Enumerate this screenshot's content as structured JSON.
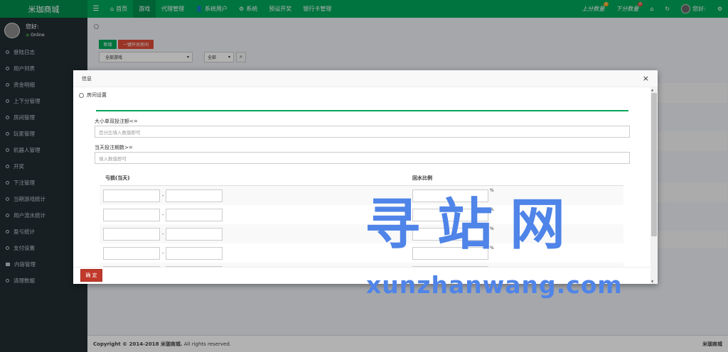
{
  "header": {
    "logo": "米珈商城",
    "toggle_icon": "bars-icon",
    "nav": [
      {
        "label": "首页",
        "icon": "home-icon"
      },
      {
        "label": "游戏",
        "active": true
      },
      {
        "label": "代理管理"
      },
      {
        "label": "系统用户",
        "icon": "user-icon"
      },
      {
        "label": "系统",
        "icon": "gear-icon"
      },
      {
        "label": "预设开奖"
      },
      {
        "label": "银行卡管理"
      }
    ],
    "right": {
      "up_score": "上分数量",
      "up_badge": "0",
      "down_score": "下分数量",
      "down_badge": "0",
      "user_name": "您好:"
    }
  },
  "sidebar": {
    "user_name": "您好:",
    "status": "Online",
    "items": [
      {
        "label": "登陆日志"
      },
      {
        "label": "用户列表"
      },
      {
        "label": "资金明细"
      },
      {
        "label": "上下分管理"
      },
      {
        "label": "房间管理"
      },
      {
        "label": "玩家管理"
      },
      {
        "label": "机器人管理"
      },
      {
        "label": "开奖"
      },
      {
        "label": "下注管理"
      },
      {
        "label": "当期游戏统计"
      },
      {
        "label": "用户流水统计"
      },
      {
        "label": "盈亏统计"
      },
      {
        "label": "支付设置"
      },
      {
        "label": "内容管理",
        "icon": "grid"
      },
      {
        "label": "清理数据"
      }
    ]
  },
  "content": {
    "add_button": "新增",
    "room_button": "一键开关房间",
    "game_select": "全部游戏",
    "status_select": "全部"
  },
  "modal": {
    "title": "信息",
    "section_title": "房间设置",
    "field1_label": "大小单双投注额<=",
    "field1_placeholder": "百分比填入数值即可",
    "field2_label": "当天投注期数>=",
    "field2_placeholder": "填入数值即可",
    "table": {
      "col1": "亏损(当天)",
      "col2": "回水比例",
      "dash": "-",
      "percent": "%"
    },
    "confirm_button": "确 定"
  },
  "footer": {
    "copyright_prefix": "Copyright © 2014-2018 ",
    "company": "米珈商城.",
    "copyright_suffix": " All rights reserved.",
    "right_text": "米珈商城"
  },
  "watermark": {
    "big": "寻站网",
    "small": "xunzhanwang.com"
  },
  "colors": {
    "header_green": "#00a65a",
    "sidebar_dark": "#222d32",
    "danger_red": "#dd4b39",
    "watermark_blue": "#4f84e8"
  }
}
